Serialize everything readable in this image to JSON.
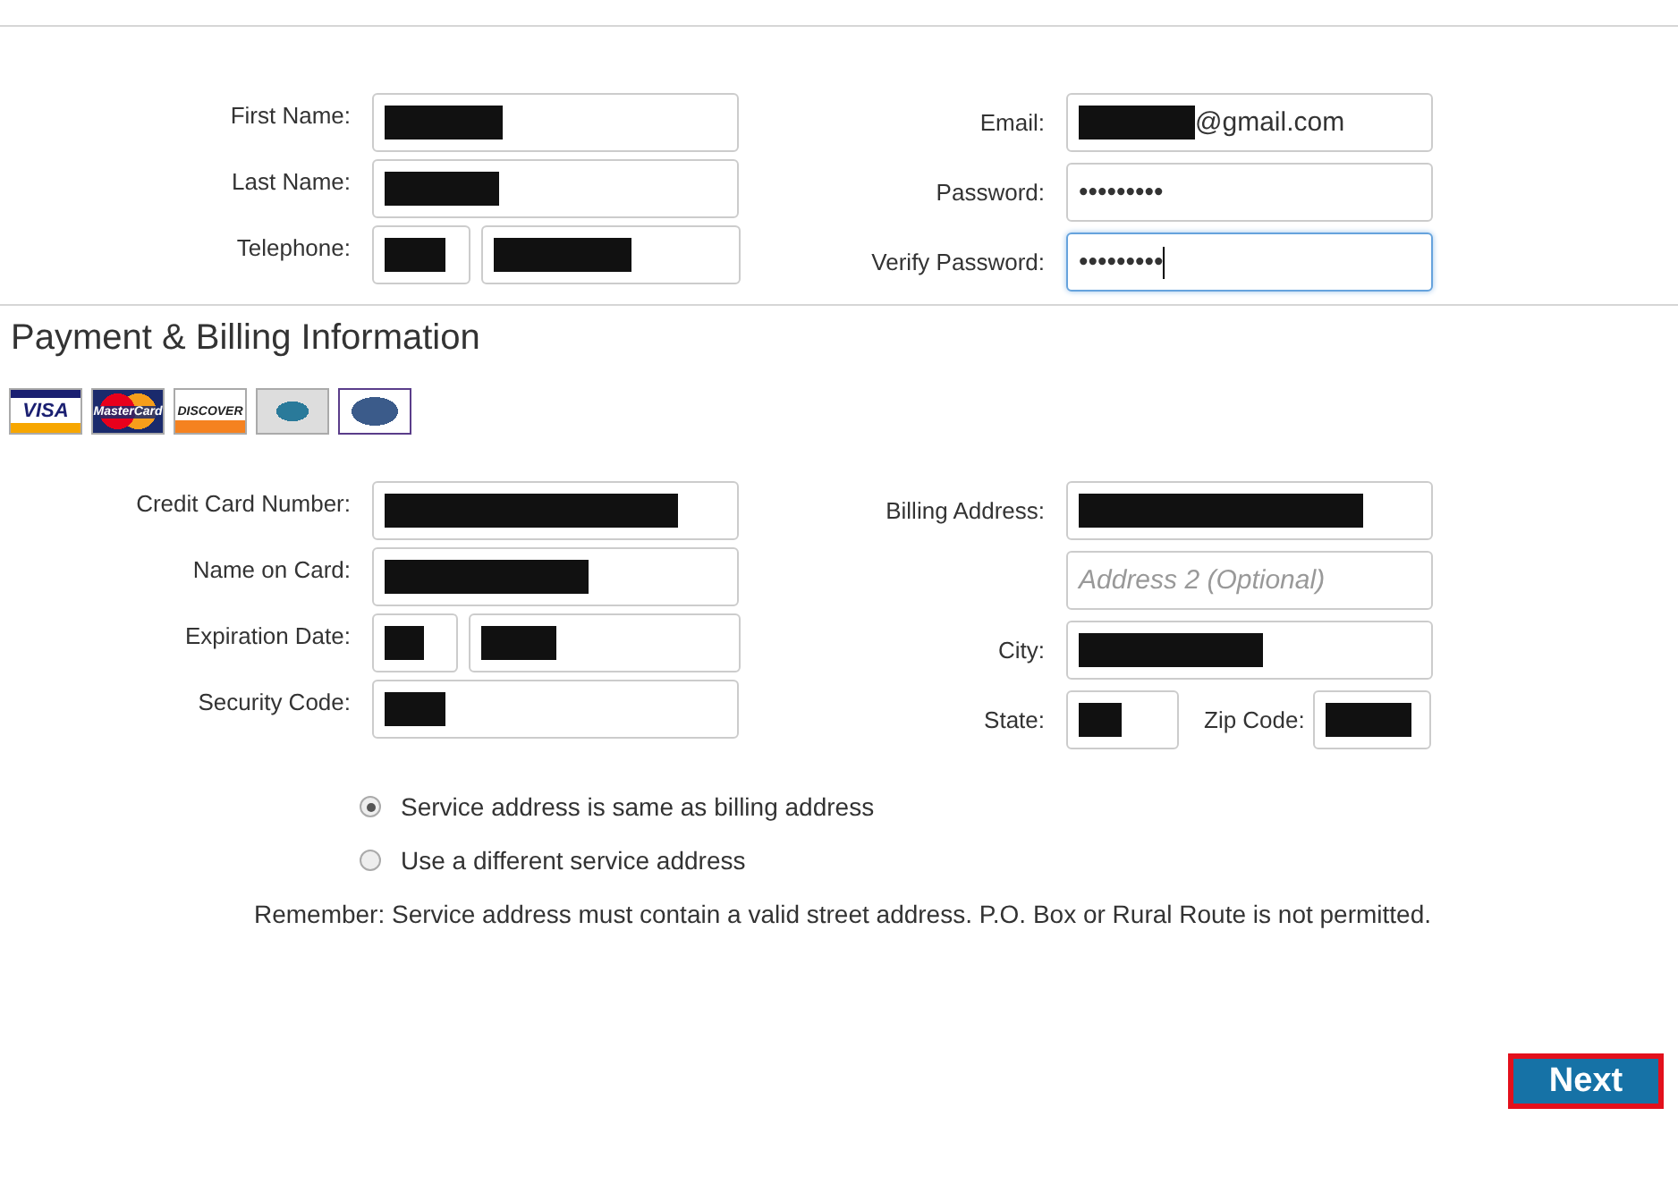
{
  "account": {
    "left": [
      {
        "label": "First Name:",
        "fields": [
          {
            "redacted": true,
            "focused": false
          }
        ]
      },
      {
        "label": "Last Name:",
        "fields": [
          {
            "redacted": true,
            "focused": false
          }
        ]
      },
      {
        "label": "Telephone:",
        "fields": [
          {
            "redacted": true,
            "focused": false
          },
          {
            "redacted": true,
            "focused": false
          }
        ]
      }
    ],
    "right": [
      {
        "label": "Email:",
        "fields": [
          {
            "redacted": true,
            "value": "@gmail.com",
            "focused": false
          }
        ]
      },
      {
        "label": "Password:",
        "fields": [
          {
            "value": "•••••••••",
            "focused": false
          }
        ]
      },
      {
        "label": "Verify Password:",
        "fields": [
          {
            "value": "•••••••••",
            "focused": true
          }
        ]
      }
    ]
  },
  "payment": {
    "title": "Payment & Billing Information",
    "cards": [
      {
        "kind": "visa",
        "label": "VISA"
      },
      {
        "kind": "mastercard",
        "label": "MasterCard"
      },
      {
        "kind": "discover",
        "label": "DISCOVER"
      },
      {
        "kind": "amex"
      },
      {
        "kind": "diners"
      }
    ],
    "left": [
      {
        "label": "Credit Card Number:",
        "fields": [
          {
            "redacted": true
          }
        ]
      },
      {
        "label": "Name on Card:",
        "fields": [
          {
            "redacted": true
          }
        ]
      },
      {
        "label": "Expiration Date:",
        "fields": [
          {
            "redacted": true
          },
          {
            "redacted": true
          }
        ]
      },
      {
        "label": "Security Code:",
        "fields": [
          {
            "redacted": true
          }
        ]
      }
    ],
    "right": [
      {
        "label": "Billing Address:",
        "fields": [
          {
            "redacted": true
          }
        ]
      },
      {
        "fields": [
          {
            "placeholder": "Address 2 (Optional)"
          }
        ]
      },
      {
        "label": "City:",
        "fields": [
          {
            "redacted": true
          }
        ]
      },
      {
        "label": "State:",
        "fields": [
          {
            "redacted": true
          }
        ],
        "extra_label": "Zip Code:",
        "extra_fields": [
          {
            "redacted": true
          }
        ]
      }
    ],
    "options": [
      {
        "label": "Service address is same as billing address",
        "selected": true
      },
      {
        "label": "Use a different service address",
        "selected": false
      }
    ],
    "note": "Remember: Service address must contain a valid street address. P.O. Box or Rural Route is not permitted."
  },
  "next_button": "Next"
}
